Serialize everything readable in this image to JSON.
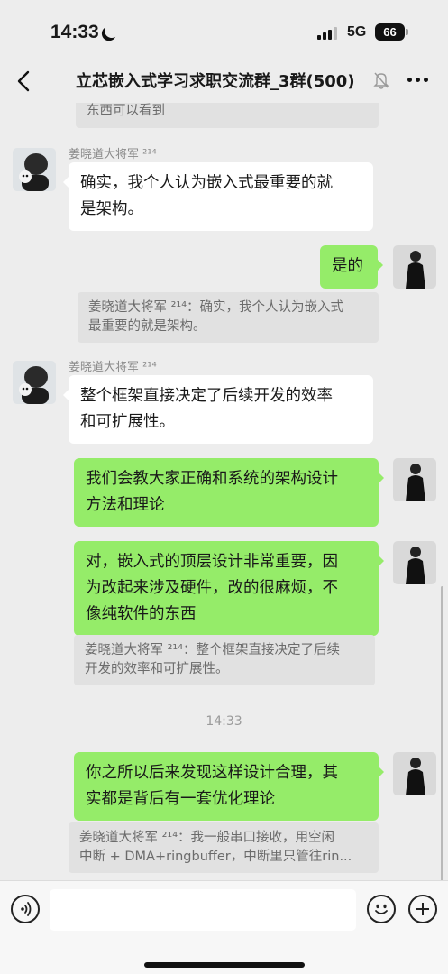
{
  "status_bar": {
    "time": "14:33",
    "network": "5G",
    "battery": "66"
  },
  "header": {
    "title": "立芯嵌入式学习求职交流群_3群(500)"
  },
  "messages": [
    {
      "type": "quote_partial",
      "text": "东西可以看到"
    },
    {
      "type": "incoming",
      "sender": "姜晓道大将军 ²¹⁴",
      "lines": [
        "确实，我个人认为嵌入式最重要的就",
        "是架构。"
      ]
    },
    {
      "type": "outgoing",
      "lines": [
        "是的"
      ]
    },
    {
      "type": "quote",
      "lines": [
        "姜晓道大将军 ²¹⁴：确实，我个人认为嵌入式",
        "最重要的就是架构。"
      ]
    },
    {
      "type": "incoming",
      "sender": "姜晓道大将军 ²¹⁴",
      "lines": [
        "整个框架直接决定了后续开发的效率",
        "和可扩展性。"
      ]
    },
    {
      "type": "outgoing",
      "lines": [
        "我们会教大家正确和系统的架构设计",
        "方法和理论"
      ]
    },
    {
      "type": "outgoing",
      "lines": [
        "对，嵌入式的顶层设计非常重要，因",
        "为改起来涉及硬件，改的很麻烦，不",
        "像纯软件的东西"
      ]
    },
    {
      "type": "quote",
      "lines": [
        "姜晓道大将军 ²¹⁴：整个框架直接决定了后续",
        "开发的效率和可扩展性。"
      ]
    },
    {
      "type": "time",
      "text": "14:33"
    },
    {
      "type": "outgoing",
      "lines": [
        "你之所以后来发现这样设计合理，其",
        "实都是背后有一套优化理论"
      ]
    },
    {
      "type": "quote",
      "lines": [
        "姜晓道大将军 ²¹⁴：我一般串口接收，用空闲",
        "中断 + DMA+ringbuffer，中断里只管往rin..."
      ]
    }
  ],
  "input_bar": {
    "value": "",
    "placeholder": ""
  },
  "colors": {
    "background": "#ededed",
    "outgoing_bubble": "#95ec69",
    "incoming_bubble": "#ffffff",
    "quote_bg": "#e1e1e1"
  },
  "icons": [
    "back-icon",
    "mute-icon",
    "more-icon",
    "voice-icon",
    "emoji-icon",
    "plus-icon",
    "moon-icon",
    "signal-icon",
    "battery-icon"
  ]
}
